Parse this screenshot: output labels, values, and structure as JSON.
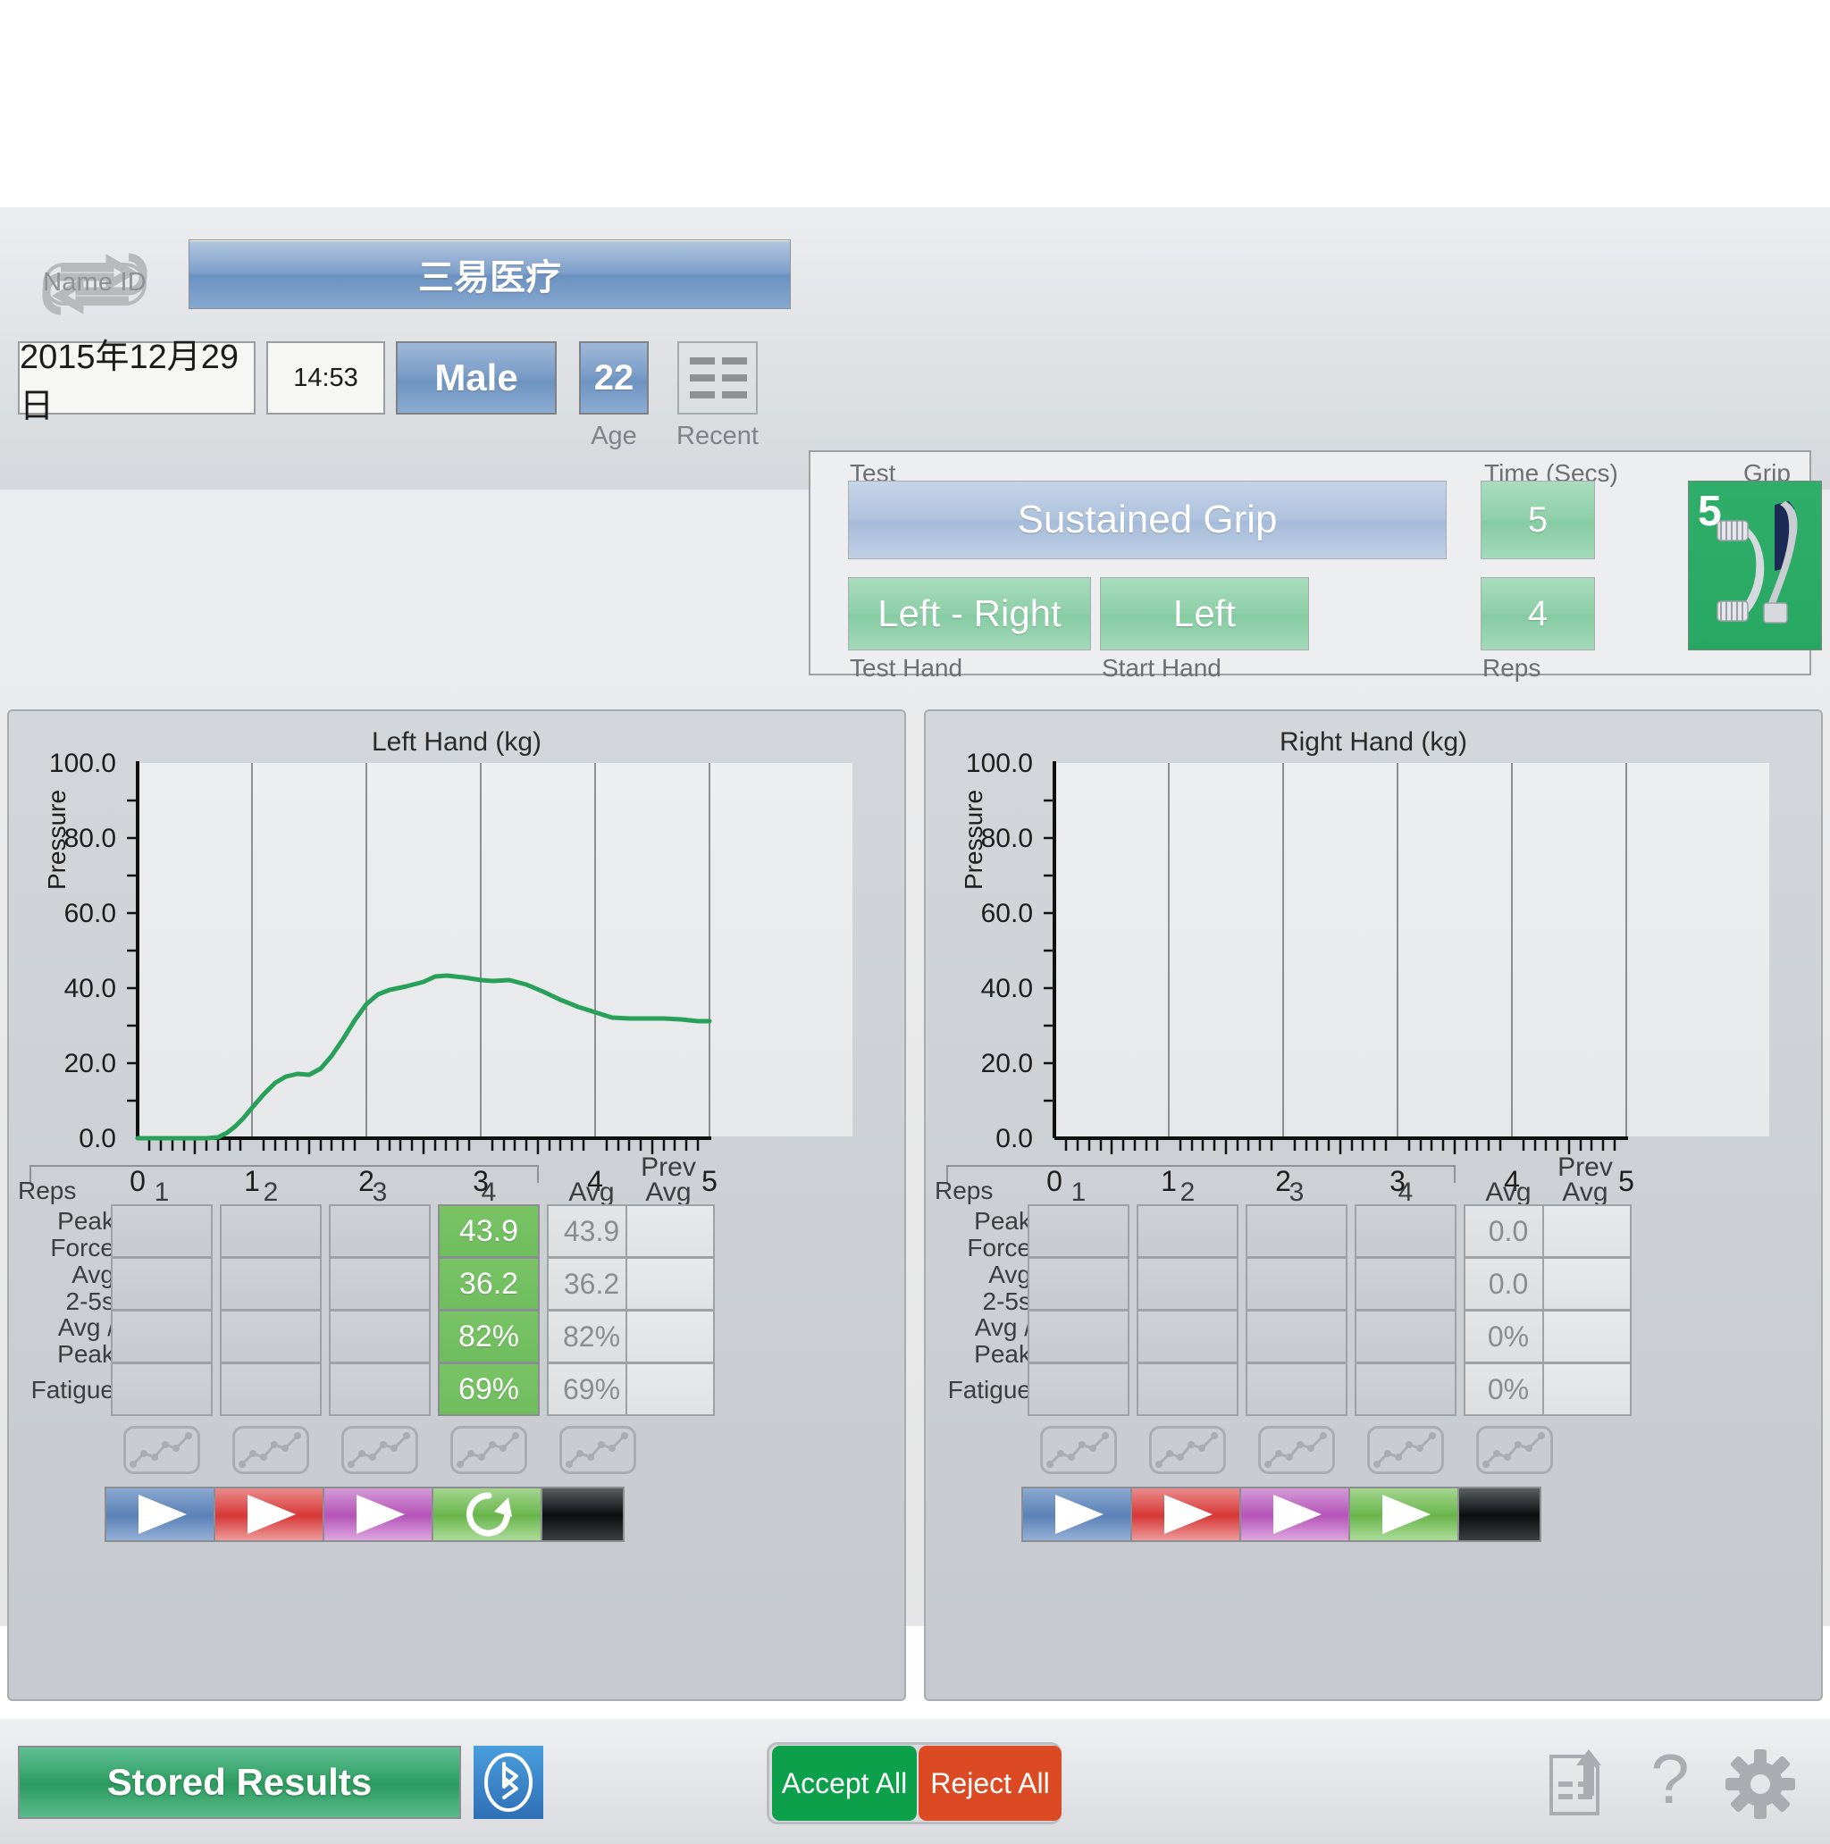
{
  "header": {
    "name_id_label": "Name ID",
    "patient_name": "三易医疗",
    "date": "2015年12月29日",
    "time": "14:53",
    "gender": "Male",
    "age_value": "22",
    "age_label": "Age",
    "recent_label": "Recent"
  },
  "test_panel": {
    "test_label": "Test",
    "test_value": "Sustained Grip",
    "test_hand_label": "Test Hand",
    "test_hand_value": "Left - Right",
    "start_hand_label": "Start Hand",
    "start_hand_value": "Left",
    "time_secs_label": "Time (Secs)",
    "time_secs_value": "5",
    "reps_label": "Reps",
    "reps_value": "4",
    "grip_label": "Grip",
    "grip_value": "5"
  },
  "left_panel": {
    "title": "Left Hand (kg)",
    "reps_header": "Reps",
    "columns": [
      "1",
      "2",
      "3",
      "4"
    ],
    "avg_header": "Avg",
    "prev_avg_header": "Prev\nAvg",
    "prev_avg_header_line1": "Prev",
    "prev_avg_header_line2": "Avg",
    "rows": [
      {
        "label_line1": "Peak",
        "label_line2": "Force",
        "cells": [
          "",
          "",
          "",
          "43.9"
        ],
        "avg": "43.9",
        "prev": ""
      },
      {
        "label_line1": "Avg",
        "label_line2": "2-5s",
        "cells": [
          "",
          "",
          "",
          "36.2"
        ],
        "avg": "36.2",
        "prev": ""
      },
      {
        "label_line1": "Avg /",
        "label_line2": "Peak",
        "cells": [
          "",
          "",
          "",
          "82%"
        ],
        "avg": "82%",
        "prev": ""
      },
      {
        "label_line1": "Fatigue",
        "label_line2": "",
        "cells": [
          "",
          "",
          "",
          "69%"
        ],
        "avg": "69%",
        "prev": ""
      }
    ],
    "action_buttons": [
      "play-blue",
      "play-red",
      "play-purple",
      "redo-green",
      "blank-black"
    ]
  },
  "right_panel": {
    "title": "Right Hand (kg)",
    "reps_header": "Reps",
    "columns": [
      "1",
      "2",
      "3",
      "4"
    ],
    "avg_header": "Avg",
    "prev_avg_header_line1": "Prev",
    "prev_avg_header_line2": "Avg",
    "rows": [
      {
        "label_line1": "Peak",
        "label_line2": "Force",
        "cells": [
          "",
          "",
          "",
          ""
        ],
        "avg": "0.0",
        "prev": ""
      },
      {
        "label_line1": "Avg",
        "label_line2": "2-5s",
        "cells": [
          "",
          "",
          "",
          ""
        ],
        "avg": "0.0",
        "prev": ""
      },
      {
        "label_line1": "Avg /",
        "label_line2": "Peak",
        "cells": [
          "",
          "",
          "",
          ""
        ],
        "avg": "0%",
        "prev": ""
      },
      {
        "label_line1": "Fatigue",
        "label_line2": "",
        "cells": [
          "",
          "",
          "",
          ""
        ],
        "avg": "0%",
        "prev": ""
      }
    ],
    "action_buttons": [
      "play-blue",
      "play-red",
      "play-purple",
      "play-green",
      "blank-black"
    ]
  },
  "bottom_bar": {
    "stored_results": "Stored Results",
    "bluetooth_icon": "bluetooth-icon",
    "accept_all": "Accept All",
    "reject_all": "Reject All",
    "export_icon": "export-document-icon",
    "help_icon": "question-mark-icon",
    "settings_icon": "gear-icon"
  },
  "colors": {
    "accent_green": "#6fbd5e",
    "grip_green": "#27a862",
    "accept_green": "#0da04b",
    "reject_red": "#dc4a23",
    "curve_green": "#28a05a",
    "blue_tile": "#7b9ec8"
  },
  "chart_data": [
    {
      "type": "line",
      "title": "Left Hand (kg)",
      "xlabel": "",
      "ylabel": "Pressure",
      "xlim": [
        0,
        5
      ],
      "ylim": [
        0,
        100
      ],
      "xticks": [
        "0",
        "1",
        "2",
        "3",
        "4",
        "5"
      ],
      "yticks": [
        "0.0",
        "20.0",
        "40.0",
        "60.0",
        "80.0",
        "100.0"
      ],
      "grid": "vertical-only",
      "series_color": "#28a05a",
      "x": [
        0.0,
        0.2,
        0.4,
        0.6,
        0.7,
        0.78,
        0.85,
        0.92,
        1.0,
        1.1,
        1.2,
        1.3,
        1.4,
        1.5,
        1.6,
        1.7,
        1.8,
        1.9,
        2.0,
        2.1,
        2.2,
        2.35,
        2.5,
        2.6,
        2.7,
        2.85,
        3.0,
        3.1,
        3.25,
        3.4,
        3.55,
        3.7,
        3.85,
        4.0,
        4.15,
        4.3,
        4.45,
        4.6,
        4.75,
        4.9,
        5.0
      ],
      "y": [
        0.0,
        0.0,
        0.0,
        0.0,
        0.3,
        1.4,
        3.0,
        5.2,
        8.0,
        11.5,
        14.6,
        16.4,
        17.2,
        17.0,
        18.6,
        22.0,
        26.5,
        31.5,
        35.8,
        38.5,
        39.7,
        40.6,
        41.8,
        43.2,
        43.5,
        43.0,
        42.2,
        42.0,
        42.2,
        41.0,
        39.0,
        37.0,
        35.0,
        33.5,
        32.2,
        32.0,
        32.0,
        31.9,
        31.6,
        31.3,
        31.3
      ]
    },
    {
      "type": "line",
      "title": "Right Hand (kg)",
      "xlabel": "",
      "ylabel": "Pressure",
      "xlim": [
        0,
        5
      ],
      "ylim": [
        0,
        100
      ],
      "xticks": [
        "0",
        "1",
        "2",
        "3",
        "4",
        "5"
      ],
      "yticks": [
        "0.0",
        "20.0",
        "40.0",
        "60.0",
        "80.0",
        "100.0"
      ],
      "grid": "vertical-only",
      "series_color": "#28a05a",
      "x": [],
      "y": []
    }
  ]
}
